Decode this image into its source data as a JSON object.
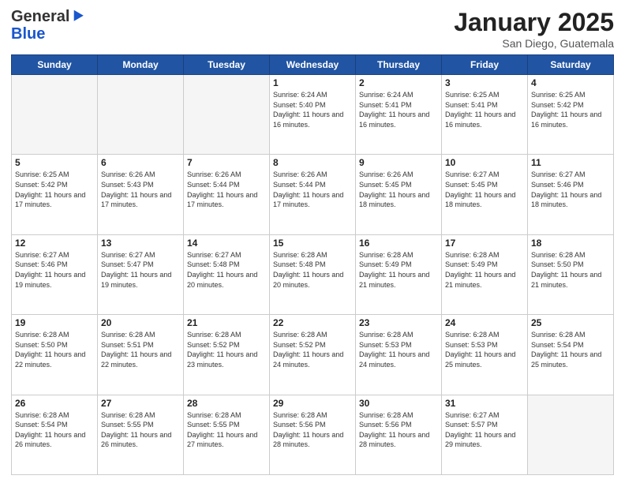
{
  "header": {
    "logo_general": "General",
    "logo_blue": "Blue",
    "title": "January 2025",
    "location": "San Diego, Guatemala"
  },
  "weekdays": [
    "Sunday",
    "Monday",
    "Tuesday",
    "Wednesday",
    "Thursday",
    "Friday",
    "Saturday"
  ],
  "weeks": [
    [
      {
        "day": "",
        "info": ""
      },
      {
        "day": "",
        "info": ""
      },
      {
        "day": "",
        "info": ""
      },
      {
        "day": "1",
        "info": "Sunrise: 6:24 AM\nSunset: 5:40 PM\nDaylight: 11 hours and 16 minutes."
      },
      {
        "day": "2",
        "info": "Sunrise: 6:24 AM\nSunset: 5:41 PM\nDaylight: 11 hours and 16 minutes."
      },
      {
        "day": "3",
        "info": "Sunrise: 6:25 AM\nSunset: 5:41 PM\nDaylight: 11 hours and 16 minutes."
      },
      {
        "day": "4",
        "info": "Sunrise: 6:25 AM\nSunset: 5:42 PM\nDaylight: 11 hours and 16 minutes."
      }
    ],
    [
      {
        "day": "5",
        "info": "Sunrise: 6:25 AM\nSunset: 5:42 PM\nDaylight: 11 hours and 17 minutes."
      },
      {
        "day": "6",
        "info": "Sunrise: 6:26 AM\nSunset: 5:43 PM\nDaylight: 11 hours and 17 minutes."
      },
      {
        "day": "7",
        "info": "Sunrise: 6:26 AM\nSunset: 5:44 PM\nDaylight: 11 hours and 17 minutes."
      },
      {
        "day": "8",
        "info": "Sunrise: 6:26 AM\nSunset: 5:44 PM\nDaylight: 11 hours and 17 minutes."
      },
      {
        "day": "9",
        "info": "Sunrise: 6:26 AM\nSunset: 5:45 PM\nDaylight: 11 hours and 18 minutes."
      },
      {
        "day": "10",
        "info": "Sunrise: 6:27 AM\nSunset: 5:45 PM\nDaylight: 11 hours and 18 minutes."
      },
      {
        "day": "11",
        "info": "Sunrise: 6:27 AM\nSunset: 5:46 PM\nDaylight: 11 hours and 18 minutes."
      }
    ],
    [
      {
        "day": "12",
        "info": "Sunrise: 6:27 AM\nSunset: 5:46 PM\nDaylight: 11 hours and 19 minutes."
      },
      {
        "day": "13",
        "info": "Sunrise: 6:27 AM\nSunset: 5:47 PM\nDaylight: 11 hours and 19 minutes."
      },
      {
        "day": "14",
        "info": "Sunrise: 6:27 AM\nSunset: 5:48 PM\nDaylight: 11 hours and 20 minutes."
      },
      {
        "day": "15",
        "info": "Sunrise: 6:28 AM\nSunset: 5:48 PM\nDaylight: 11 hours and 20 minutes."
      },
      {
        "day": "16",
        "info": "Sunrise: 6:28 AM\nSunset: 5:49 PM\nDaylight: 11 hours and 21 minutes."
      },
      {
        "day": "17",
        "info": "Sunrise: 6:28 AM\nSunset: 5:49 PM\nDaylight: 11 hours and 21 minutes."
      },
      {
        "day": "18",
        "info": "Sunrise: 6:28 AM\nSunset: 5:50 PM\nDaylight: 11 hours and 21 minutes."
      }
    ],
    [
      {
        "day": "19",
        "info": "Sunrise: 6:28 AM\nSunset: 5:50 PM\nDaylight: 11 hours and 22 minutes."
      },
      {
        "day": "20",
        "info": "Sunrise: 6:28 AM\nSunset: 5:51 PM\nDaylight: 11 hours and 22 minutes."
      },
      {
        "day": "21",
        "info": "Sunrise: 6:28 AM\nSunset: 5:52 PM\nDaylight: 11 hours and 23 minutes."
      },
      {
        "day": "22",
        "info": "Sunrise: 6:28 AM\nSunset: 5:52 PM\nDaylight: 11 hours and 24 minutes."
      },
      {
        "day": "23",
        "info": "Sunrise: 6:28 AM\nSunset: 5:53 PM\nDaylight: 11 hours and 24 minutes."
      },
      {
        "day": "24",
        "info": "Sunrise: 6:28 AM\nSunset: 5:53 PM\nDaylight: 11 hours and 25 minutes."
      },
      {
        "day": "25",
        "info": "Sunrise: 6:28 AM\nSunset: 5:54 PM\nDaylight: 11 hours and 25 minutes."
      }
    ],
    [
      {
        "day": "26",
        "info": "Sunrise: 6:28 AM\nSunset: 5:54 PM\nDaylight: 11 hours and 26 minutes."
      },
      {
        "day": "27",
        "info": "Sunrise: 6:28 AM\nSunset: 5:55 PM\nDaylight: 11 hours and 26 minutes."
      },
      {
        "day": "28",
        "info": "Sunrise: 6:28 AM\nSunset: 5:55 PM\nDaylight: 11 hours and 27 minutes."
      },
      {
        "day": "29",
        "info": "Sunrise: 6:28 AM\nSunset: 5:56 PM\nDaylight: 11 hours and 28 minutes."
      },
      {
        "day": "30",
        "info": "Sunrise: 6:28 AM\nSunset: 5:56 PM\nDaylight: 11 hours and 28 minutes."
      },
      {
        "day": "31",
        "info": "Sunrise: 6:27 AM\nSunset: 5:57 PM\nDaylight: 11 hours and 29 minutes."
      },
      {
        "day": "",
        "info": ""
      }
    ]
  ]
}
